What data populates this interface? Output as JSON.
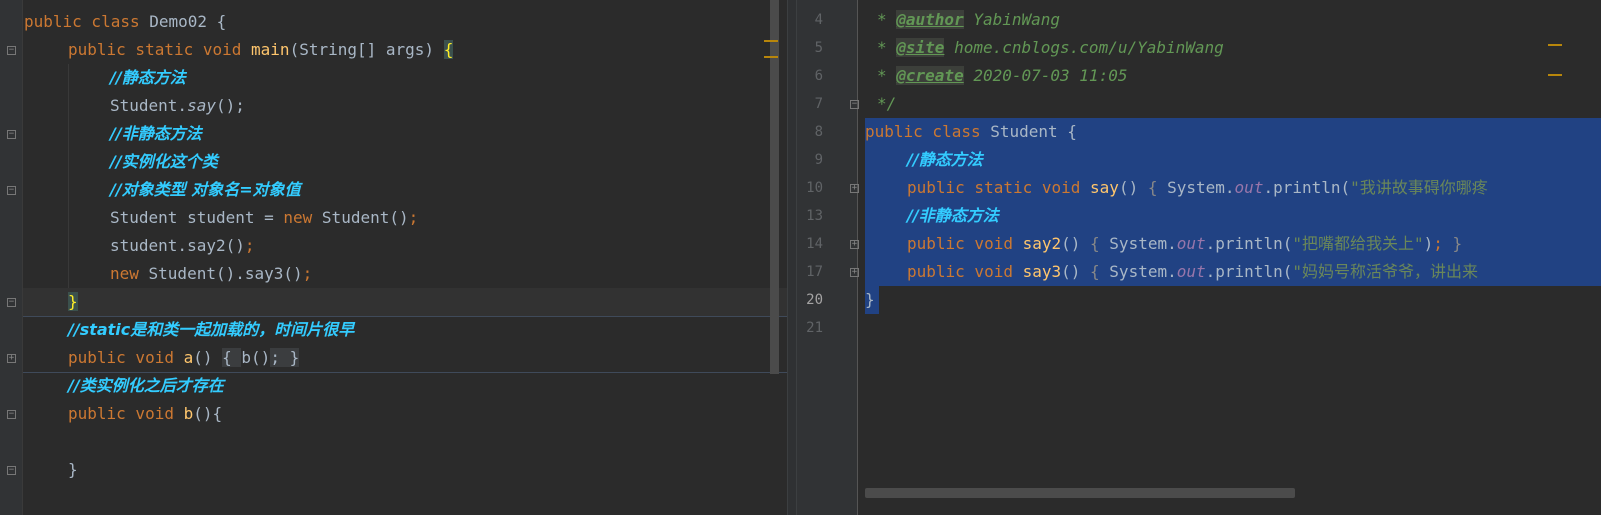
{
  "left_editor": {
    "lines": [
      "public class Demo02 {",
      "public static void main(String[] args) {",
      "//静态方法",
      "Student.say();",
      "//非静态方法",
      "//实例化这个类",
      "//对象类型 对象名=对象值",
      "Student student = new Student();",
      "student.say2();",
      "new Student().say3();",
      "}",
      "//static是和类一起加载的，时间片很早",
      "public void a() { b(); }",
      "//类实例化之后才存在",
      "public void b(){",
      "",
      "}"
    ]
  },
  "right_editor": {
    "line_numbers": [
      "4",
      "5",
      "6",
      "7",
      "8",
      "9",
      "10",
      "13",
      "14",
      "17",
      "20",
      "21"
    ],
    "current_line": "20",
    "lines": [
      "* @author YabinWang",
      "* @site home.cnblogs.com/u/YabinWang",
      "* @create 2020-07-03 11:05",
      "*/",
      "public class Student {",
      "//静态方法",
      "public static void say() { System.out.println(\"我讲故事碍你哪疼",
      "//非静态方法",
      "public void say2() { System.out.println(\"把嘴都给我关上\"); }",
      "public void say3() { System.out.println(\"妈妈号称活爷爷，讲出来",
      "}",
      ""
    ]
  },
  "colors": {
    "background": "#2b2b2b",
    "keyword": "#cc7832",
    "method": "#ffc66d",
    "comment": "#33ccff",
    "doc": "#629755",
    "string": "#6a8759",
    "static_field": "#9876aa",
    "selection": "#214283"
  },
  "icons": [
    "fold-icon",
    "unfold-icon",
    "scrollbar"
  ]
}
